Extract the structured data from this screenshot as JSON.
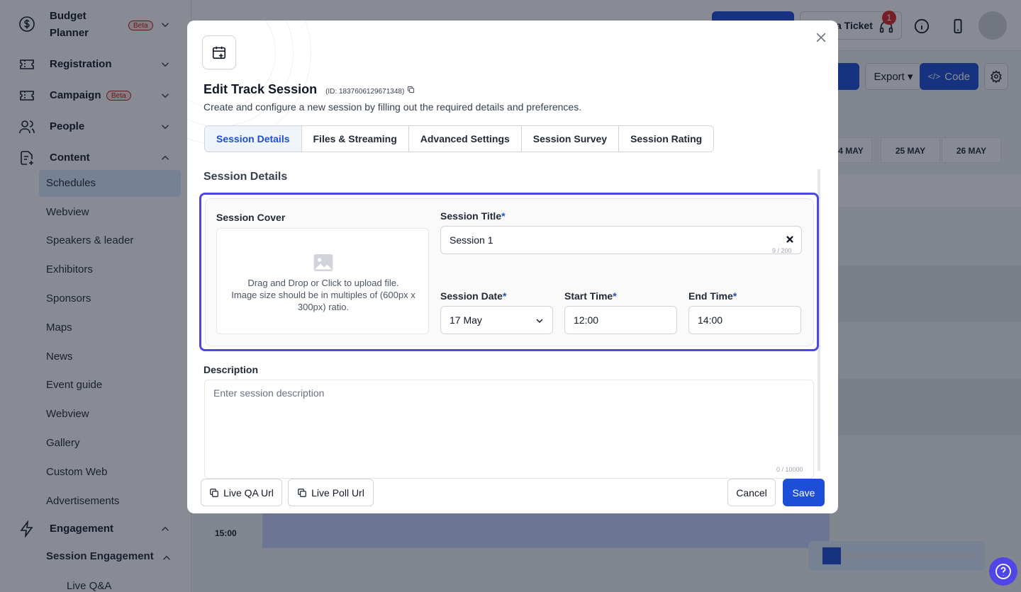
{
  "sidebar": {
    "sections": [
      {
        "label": "Budget",
        "label2": "Planner",
        "badge": "Beta",
        "icon": "dollar-circle-icon",
        "expanded": false
      },
      {
        "label": "Registration",
        "icon": "ticket-icon",
        "expanded": false
      },
      {
        "label": "Campaign",
        "badge": "Beta",
        "icon": "ticket-icon",
        "expanded": false
      },
      {
        "label": "People",
        "icon": "users-icon",
        "expanded": false
      },
      {
        "label": "Content",
        "icon": "document-plus-icon",
        "expanded": true
      },
      {
        "label": "Engagement",
        "icon": "lightning-icon",
        "expanded": true
      }
    ],
    "content_items": [
      "Schedules",
      "Webview",
      "Speakers & leader",
      "Exhibitors",
      "Sponsors",
      "Maps",
      "News",
      "Event guide",
      "Webview",
      "Gallery",
      "Custom Web",
      "Advertisements"
    ],
    "active_item": "Schedules",
    "engagement_sub": "Session Engagement",
    "engagement_items": [
      "Live Q&A"
    ]
  },
  "topbar": {
    "ticket_label": "a Ticket",
    "notification_count": "1"
  },
  "toolbar": {
    "export_label": "Export",
    "code_label": "Code"
  },
  "schedule": {
    "dates": [
      "4 MAY",
      "25 MAY",
      "26 MAY"
    ],
    "time_label": "15:00"
  },
  "modal": {
    "title": "Edit Track Session",
    "id_text": "(ID: 1837606129671348)",
    "subtitle": "Create and configure a new session by filling out the required details and preferences.",
    "tabs": [
      "Session Details",
      "Files & Streaming",
      "Advanced Settings",
      "Session Survey",
      "Session Rating"
    ],
    "active_tab": "Session Details",
    "section_title": "Session Details",
    "cover": {
      "label": "Session Cover",
      "line1": "Drag and Drop or Click to upload file.",
      "line2": "Image size should be in multiples of (600px x 300px) ratio."
    },
    "session_title": {
      "label": "Session Title",
      "required": "*",
      "value": "Session 1",
      "counter": "9 / 200"
    },
    "session_date": {
      "label": "Session Date",
      "required": "*",
      "value": "17 May"
    },
    "start_time": {
      "label": "Start Time",
      "required": "*",
      "value": "12:00"
    },
    "end_time": {
      "label": "End Time",
      "required": "*",
      "value": "14:00"
    },
    "description": {
      "label": "Description",
      "placeholder": "Enter session description",
      "counter": "0 / 10000"
    },
    "footer": {
      "live_qa": "Live QA Url",
      "live_poll": "Live Poll Url",
      "cancel": "Cancel",
      "save": "Save"
    }
  },
  "colors": {
    "accent": "#1d4ed8",
    "highlight": "#4f46e5",
    "beta": "#b91c1c"
  }
}
